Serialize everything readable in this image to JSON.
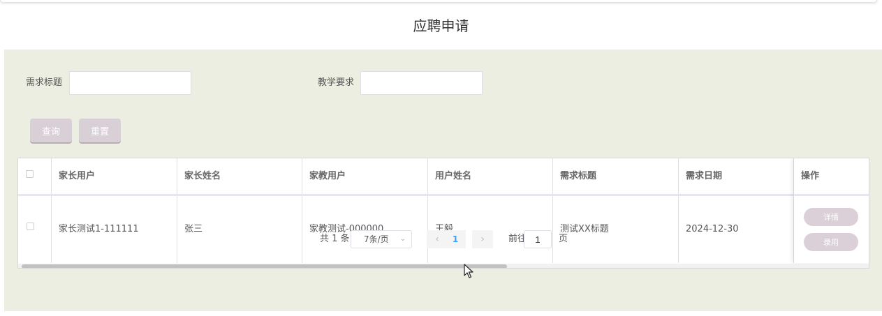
{
  "page": {
    "title": "应聘申请"
  },
  "search": {
    "field1_label": "需求标题",
    "field1_value": "",
    "field2_label": "教学要求",
    "field2_value": "",
    "query_button": "查询",
    "reset_button": "重置"
  },
  "table": {
    "columns": [
      "家长用户",
      "家长姓名",
      "家教用户",
      "用户姓名",
      "需求标题",
      "需求日期",
      "操作"
    ],
    "rows": [
      {
        "parent_user": "家长测试1-111111",
        "parent_name": "张三",
        "tutor_user": "家教测试-000000",
        "user_name": "王毅",
        "demand_title": "测试XX标题",
        "demand_date": "2024-12-30",
        "actions": {
          "detail": "详情",
          "hire": "录用"
        }
      }
    ]
  },
  "pagination": {
    "total_text": "共 1 条",
    "page_size": "7条/页",
    "current_page": "1",
    "goto_label": "前往",
    "goto_value": "1",
    "page_suffix": "页"
  },
  "icons": {
    "prev": "chevron-left-icon",
    "next": "chevron-right-icon",
    "dropdown": "chevron-down-icon",
    "cursor": "mouse-pointer-icon"
  },
  "colors": {
    "panel_bg": "#ebeee0",
    "button_bg": "#d9cfd6",
    "active_page": "#409eff"
  }
}
